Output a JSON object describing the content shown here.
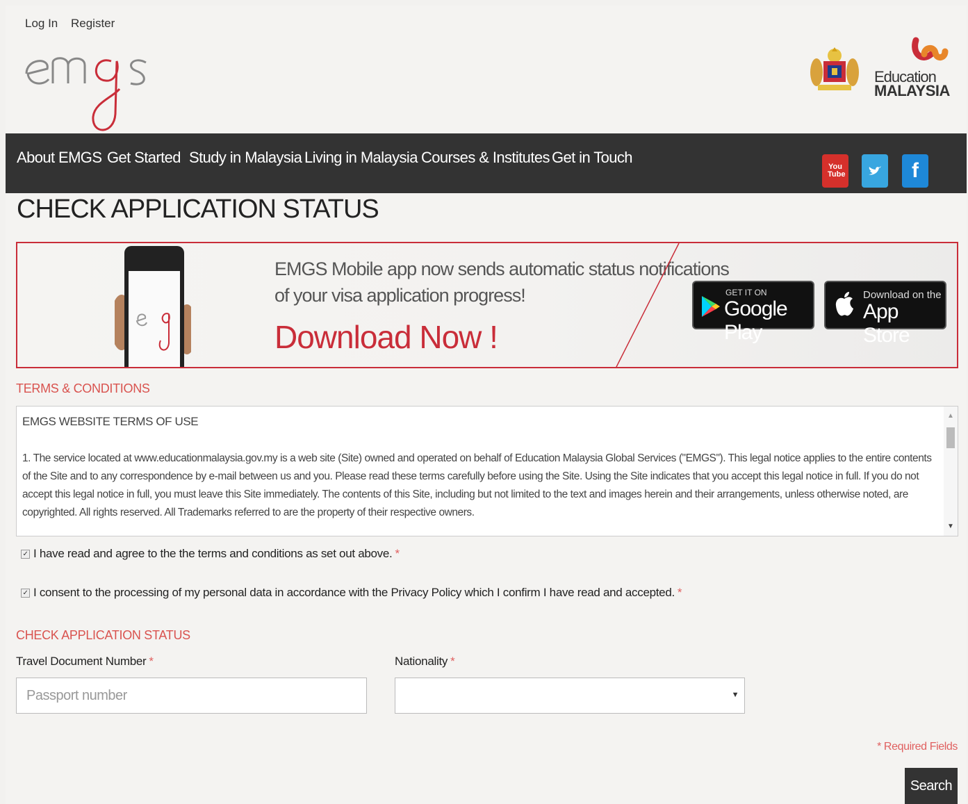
{
  "header": {
    "login_label": "Log In",
    "register_label": "Register"
  },
  "nav": {
    "items": [
      "About EMGS",
      "Get Started",
      "Study in Malaysia",
      "Living in Malaysia",
      "Courses & Institutes",
      "Get in Touch"
    ]
  },
  "social": {
    "youtube_label": "You Tube",
    "twitter_icon": "twitter-icon",
    "facebook_label": "f"
  },
  "brand": {
    "education_line1": "Education",
    "education_line2": "MALAYSIA"
  },
  "page_title": "CHECK APPLICATION STATUS",
  "banner": {
    "line1": "EMGS Mobile app now sends automatic status notifications",
    "line2": "of your visa application progress!",
    "download": "Download Now !",
    "google_small": "GET IT ON",
    "google_big": "Google Play",
    "apple_small": "Download on the",
    "apple_big": "App Store"
  },
  "terms": {
    "section_label": "TERMS & CONDITIONS",
    "heading": "EMGS WEBSITE TERMS OF USE",
    "body": "1. The service located at www.educationmalaysia.gov.my is a web site (Site) owned and operated on behalf of Education Malaysia Global Services (\"EMGS\"). This legal notice applies to the entire contents of the Site and to any correspondence by e-mail between us and you. Please read these terms carefully before using the Site. Using the Site indicates that you accept this legal notice in full. If you do not accept this legal notice in full, you must leave this Site immediately. The contents of this Site, including but not limited to the text and images herein and their arrangements, unless otherwise noted, are copyrighted. All rights reserved. All Trademarks referred to are the property of their respective owners."
  },
  "checks": {
    "agree_label": "I have read and agree to the the terms and conditions as set out above.",
    "consent_label": "I consent to the processing of my personal data in accordance with the Privacy Policy which I confirm I have read and accepted.",
    "required_mark": "*"
  },
  "form": {
    "section_label": "CHECK APPLICATION STATUS",
    "travel_doc_label": "Travel Document Number",
    "travel_doc_placeholder": "Passport number",
    "nationality_label": "Nationality",
    "nationality_value": "",
    "required_note": "* Required Fields",
    "search_label": "Search"
  },
  "colors": {
    "accent_red": "#c92d39",
    "nav_bg": "#333333"
  }
}
